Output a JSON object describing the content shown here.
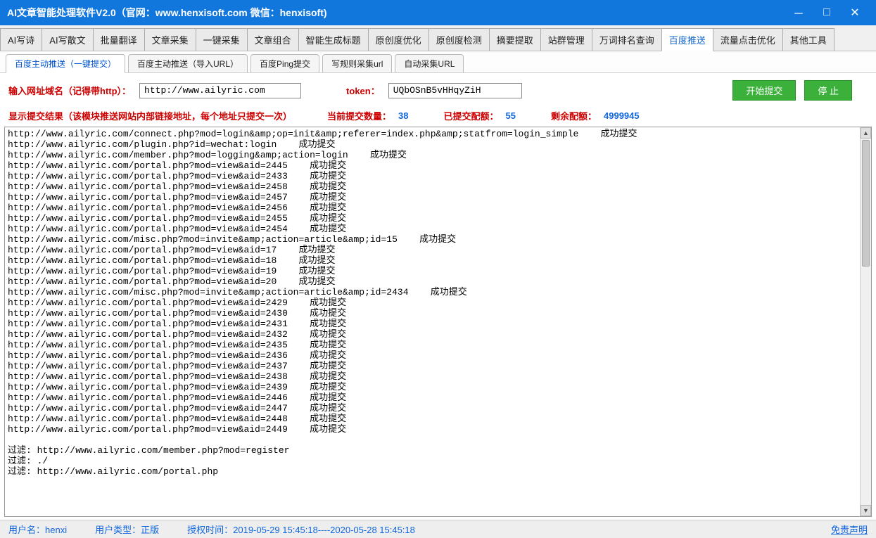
{
  "title": "AI文章智能处理软件V2.0（官网：www.henxisoft.com 微信：henxisoft)",
  "main_tabs": [
    "AI写诗",
    "AI写散文",
    "批量翻译",
    "文章采集",
    "一键采集",
    "文章组合",
    "智能生成标题",
    "原创度优化",
    "原创度检测",
    "摘要提取",
    "站群管理",
    "万词排名查询",
    "百度推送",
    "流量点击优化",
    "其他工具"
  ],
  "main_tab_active": 12,
  "sub_tabs": [
    "百度主动推送（一键提交）",
    "百度主动推送（导入URL）",
    "百度Ping提交",
    "写规则采集url",
    "自动采集URL"
  ],
  "sub_tab_active": 0,
  "form": {
    "url_label": "输入网址域名（记得带http）：",
    "url_value": "http://www.ailyric.com",
    "token_label": "token：",
    "token_value": "UQbOSnB5vHHqyZiH",
    "start_btn": "开始提交",
    "stop_btn": "停 止"
  },
  "stats": {
    "result_label": "显示提交结果（该模块推送网站内部链接地址，每个地址只提交一次）",
    "current_label": "当前提交数量：",
    "current_value": "38",
    "submitted_label": "已提交配额：",
    "submitted_value": "55",
    "remain_label": "剩余配额：",
    "remain_value": "4999945"
  },
  "log_lines": [
    "http://www.ailyric.com/connect.php?mod=login&amp;op=init&amp;referer=index.php&amp;statfrom=login_simple    成功提交",
    "http://www.ailyric.com/plugin.php?id=wechat:login    成功提交",
    "http://www.ailyric.com/member.php?mod=logging&amp;action=login    成功提交",
    "http://www.ailyric.com/portal.php?mod=view&aid=2445    成功提交",
    "http://www.ailyric.com/portal.php?mod=view&aid=2433    成功提交",
    "http://www.ailyric.com/portal.php?mod=view&aid=2458    成功提交",
    "http://www.ailyric.com/portal.php?mod=view&aid=2457    成功提交",
    "http://www.ailyric.com/portal.php?mod=view&aid=2456    成功提交",
    "http://www.ailyric.com/portal.php?mod=view&aid=2455    成功提交",
    "http://www.ailyric.com/portal.php?mod=view&aid=2454    成功提交",
    "http://www.ailyric.com/misc.php?mod=invite&amp;action=article&amp;id=15    成功提交",
    "http://www.ailyric.com/portal.php?mod=view&aid=17    成功提交",
    "http://www.ailyric.com/portal.php?mod=view&aid=18    成功提交",
    "http://www.ailyric.com/portal.php?mod=view&aid=19    成功提交",
    "http://www.ailyric.com/portal.php?mod=view&aid=20    成功提交",
    "http://www.ailyric.com/misc.php?mod=invite&amp;action=article&amp;id=2434    成功提交",
    "http://www.ailyric.com/portal.php?mod=view&aid=2429    成功提交",
    "http://www.ailyric.com/portal.php?mod=view&aid=2430    成功提交",
    "http://www.ailyric.com/portal.php?mod=view&aid=2431    成功提交",
    "http://www.ailyric.com/portal.php?mod=view&aid=2432    成功提交",
    "http://www.ailyric.com/portal.php?mod=view&aid=2435    成功提交",
    "http://www.ailyric.com/portal.php?mod=view&aid=2436    成功提交",
    "http://www.ailyric.com/portal.php?mod=view&aid=2437    成功提交",
    "http://www.ailyric.com/portal.php?mod=view&aid=2438    成功提交",
    "http://www.ailyric.com/portal.php?mod=view&aid=2439    成功提交",
    "http://www.ailyric.com/portal.php?mod=view&aid=2446    成功提交",
    "http://www.ailyric.com/portal.php?mod=view&aid=2447    成功提交",
    "http://www.ailyric.com/portal.php?mod=view&aid=2448    成功提交",
    "http://www.ailyric.com/portal.php?mod=view&aid=2449    成功提交",
    "",
    "过滤: http://www.ailyric.com/member.php?mod=register",
    "过滤: ./",
    "过滤: http://www.ailyric.com/portal.php"
  ],
  "status": {
    "user_label": "用户名：",
    "user_value": "henxi",
    "type_label": "用户类型：",
    "type_value": "正版",
    "auth_label": "授权时间：",
    "auth_value": "2019-05-29 15:45:18----2020-05-28 15:45:18",
    "disclaimer": "免责声明"
  }
}
